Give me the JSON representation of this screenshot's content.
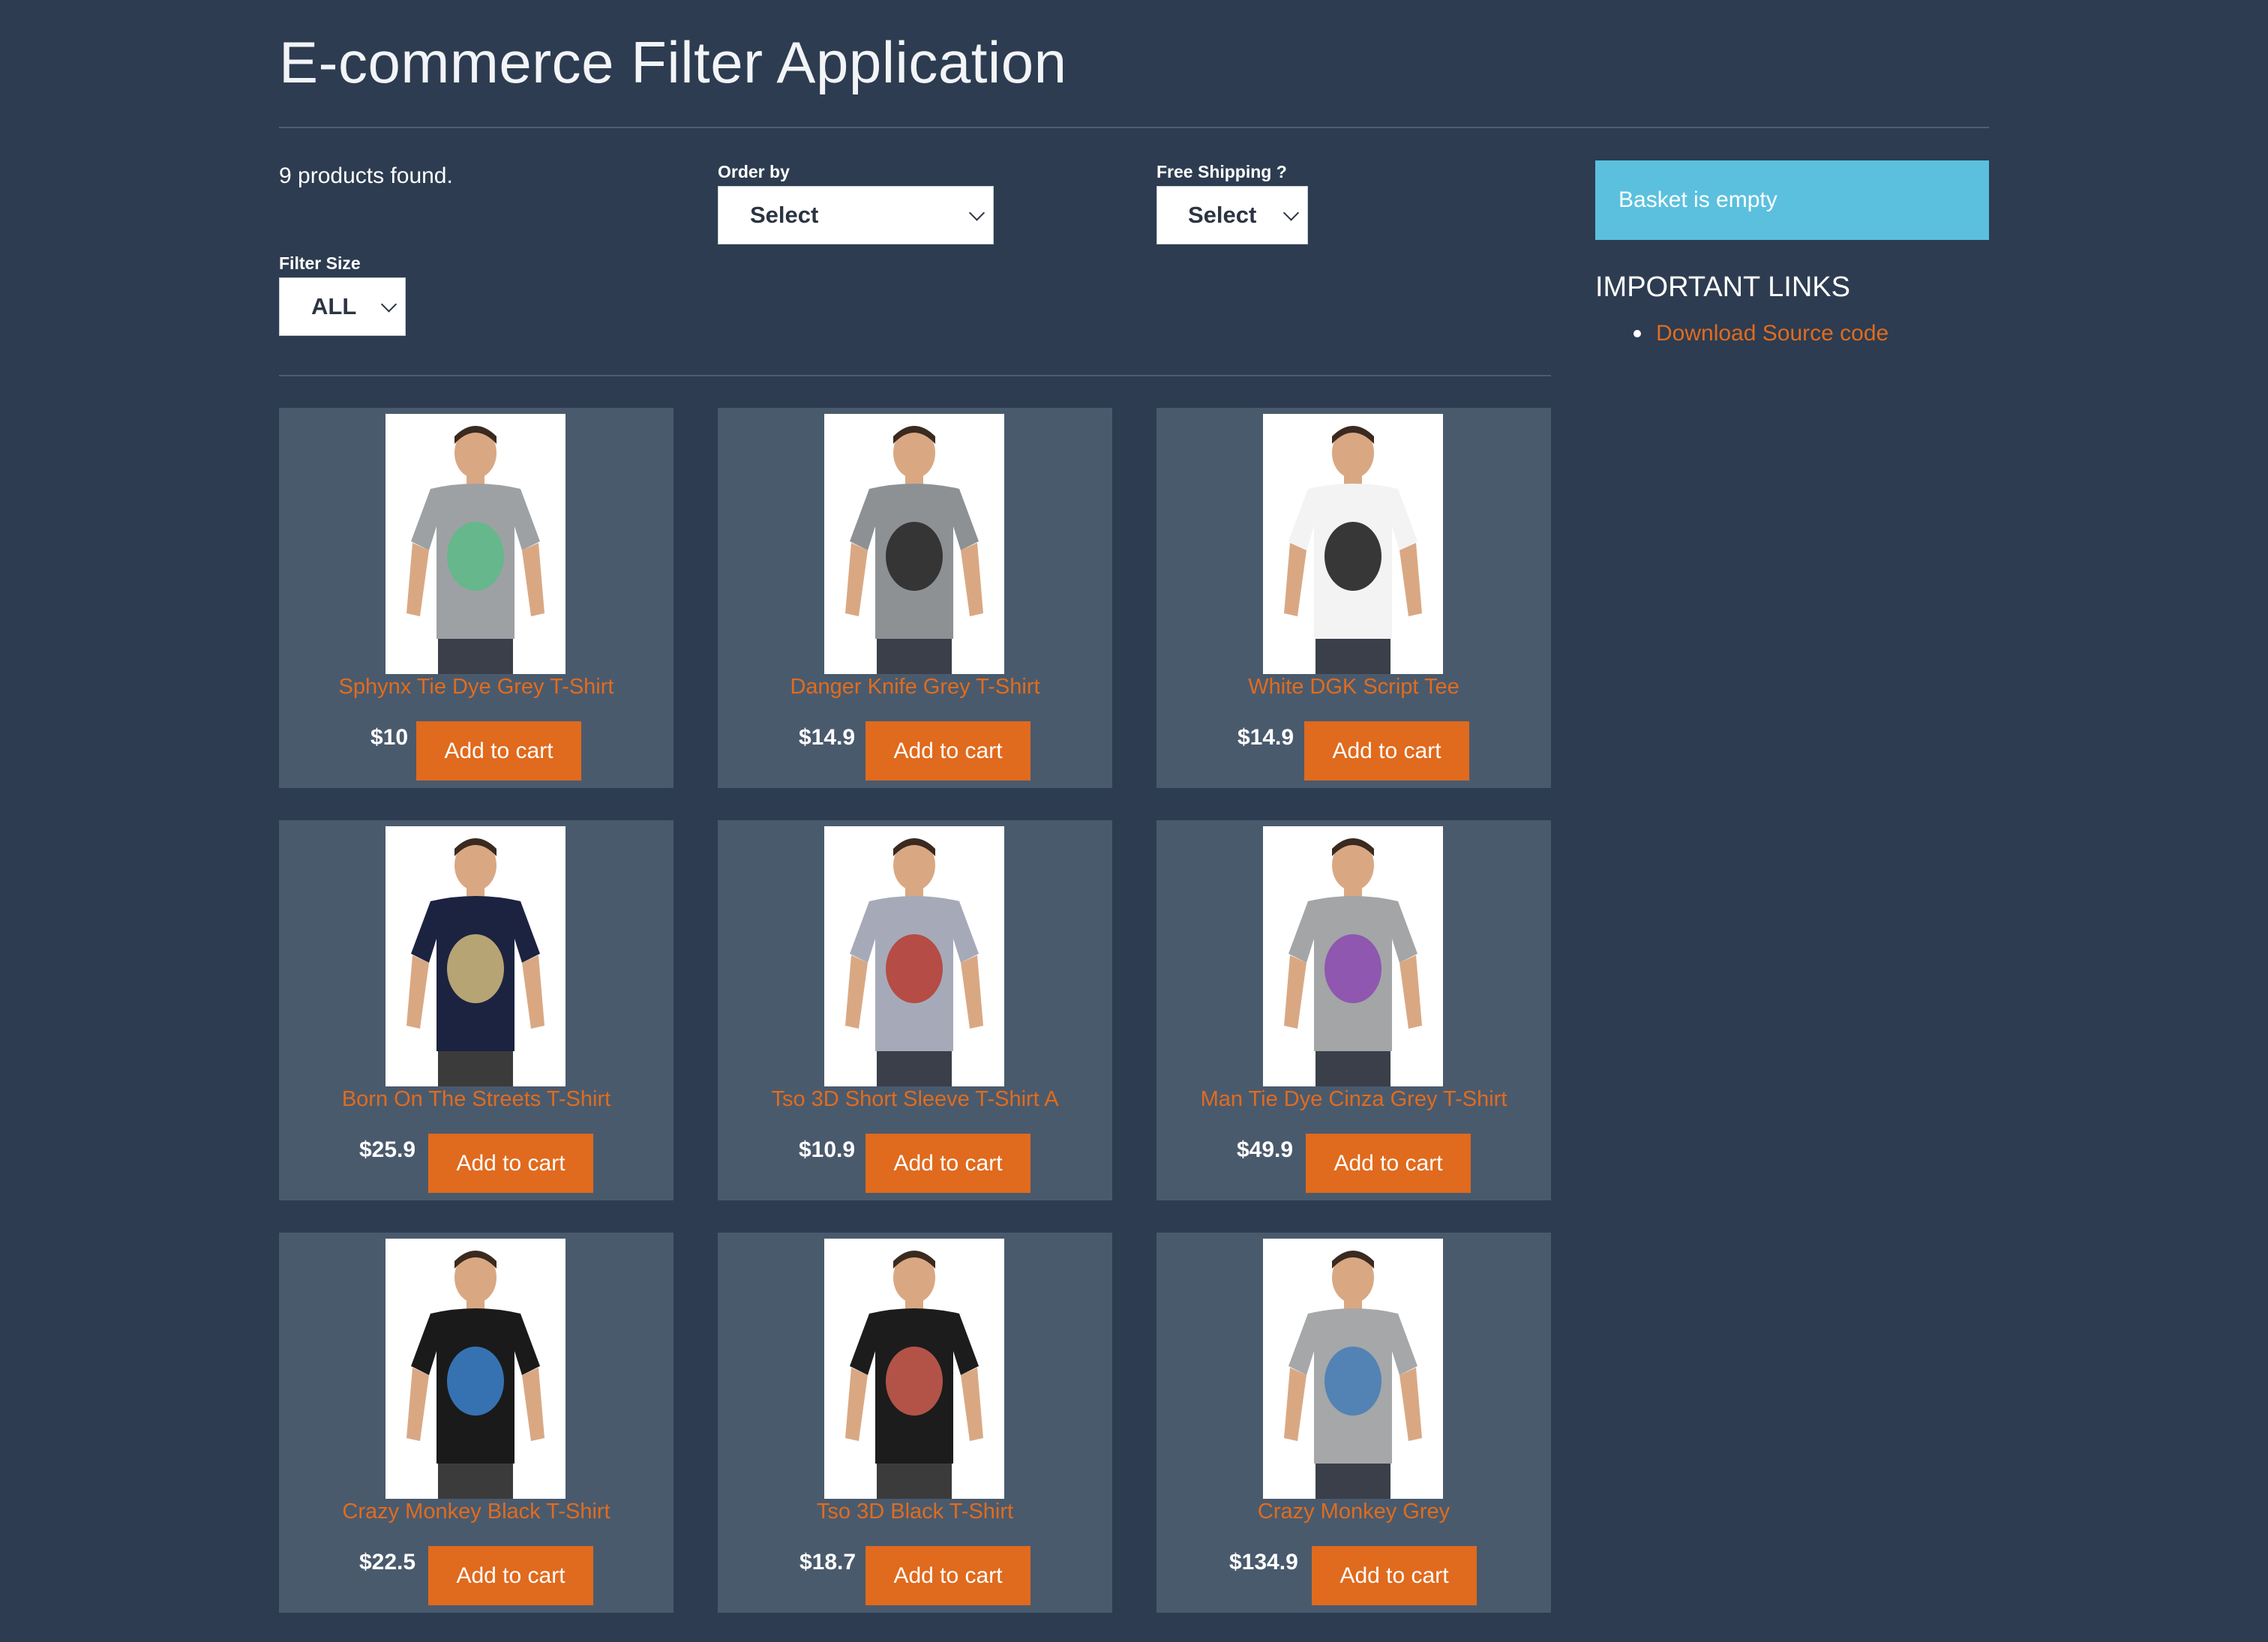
{
  "header": {
    "title": "E-commerce Filter Application"
  },
  "filters": {
    "count_text": "9 products found.",
    "order_label": "Order by",
    "order_value": "Select",
    "shipping_label": "Free Shipping ?",
    "shipping_value": "Select",
    "size_label": "Filter Size",
    "size_value": "ALL"
  },
  "sidebar": {
    "basket_text": "Basket is empty",
    "links_title": "IMPORTANT LINKS",
    "links": [
      {
        "label": "Download Source code"
      }
    ]
  },
  "products": [
    {
      "name": "Sphynx Tie Dye Grey T-Shirt",
      "price": "$10",
      "button": "Add to cart",
      "shirt": "#9ea1a4",
      "print": "#5fb98a"
    },
    {
      "name": "Danger Knife Grey T-Shirt",
      "price": "$14.9",
      "button": "Add to cart",
      "shirt": "#8e9194",
      "print": "#2b2b2b"
    },
    {
      "name": "White DGK Script Tee",
      "price": "$14.9",
      "button": "Add to cart",
      "shirt": "#f3f3f3",
      "print": "#222222"
    },
    {
      "name": "Born On The Streets T-Shirt",
      "price": "$25.9",
      "button": "Add to cart",
      "shirt": "#1b2340",
      "print": "#c9b37a"
    },
    {
      "name": "Tso 3D Short Sleeve T-Shirt A",
      "price": "$10.9",
      "button": "Add to cart",
      "shirt": "#a6aab8",
      "print": "#b7413a"
    },
    {
      "name": "Man Tie Dye Cinza Grey T-Shirt",
      "price": "$49.9",
      "button": "Add to cart",
      "shirt": "#a3a5a7",
      "print": "#8d4fb0"
    },
    {
      "name": "Crazy Monkey Black T-Shirt",
      "price": "$22.5",
      "button": "Add to cart",
      "shirt": "#1a1a1a",
      "print": "#3a7cc2"
    },
    {
      "name": "Tso 3D Black T-Shirt",
      "price": "$18.7",
      "button": "Add to cart",
      "shirt": "#1c1c1c",
      "print": "#c45a4e"
    },
    {
      "name": "Crazy Monkey Grey",
      "price": "$134.9",
      "button": "Add to cart",
      "shirt": "#a5a7a9",
      "print": "#4a7fb5"
    }
  ],
  "colors": {
    "background": "#2d3c50",
    "card": "#4a5a6d",
    "accent": "#e06a1d",
    "basket": "#5bc0de"
  }
}
